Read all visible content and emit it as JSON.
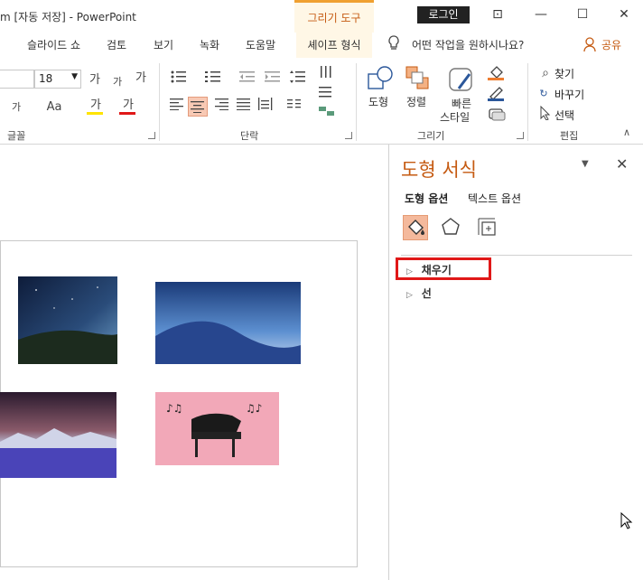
{
  "titlebar": {
    "doc_title": "m [자동 저장]  -  PowerPoint",
    "context_tab": "그리기 도구",
    "login_label": "로그인",
    "window_buttons": [
      "⊡",
      "—",
      "☐",
      "✕"
    ]
  },
  "ribbon_tabs": [
    "슬라이드 쇼",
    "검토",
    "보기",
    "녹화",
    "도움말",
    "셰이프 형식"
  ],
  "tell_me": {
    "icon": "lightbulb-icon",
    "placeholder": "어떤 작업을 원하시나요?"
  },
  "share_label": "공유",
  "font_group": {
    "font_size": "18",
    "label": "글꼴",
    "grow_label": "가",
    "shrink_label": "가",
    "clear_label": "가",
    "spacing_label": "가",
    "case_label": "Aa",
    "highlight_label": "가",
    "font_color_label": "가"
  },
  "paragraph_group": {
    "label": "단락"
  },
  "drawing_group": {
    "label": "그리기",
    "shape_label": "도형",
    "arrange_label": "정렬",
    "quick_style_label_1": "빠른",
    "quick_style_label_2": "스타일"
  },
  "editing_group": {
    "label": "편집",
    "find_label": "찾기",
    "replace_label": "바꾸기",
    "select_label": "선택"
  },
  "format_pane": {
    "title": "도형 서식",
    "tabs": [
      "도형 옵션",
      "텍스트 옵션"
    ],
    "active_tab": "도형 옵션",
    "icons": [
      "fill-line-icon",
      "effects-pentagon-icon",
      "size-properties-icon"
    ],
    "sections": [
      "채우기",
      "선"
    ],
    "highlighted_section": "채우기"
  },
  "colors": {
    "accent": "#c55a11",
    "highlight_box": "#e01818",
    "selected_icon_bg": "#f4b99c"
  }
}
